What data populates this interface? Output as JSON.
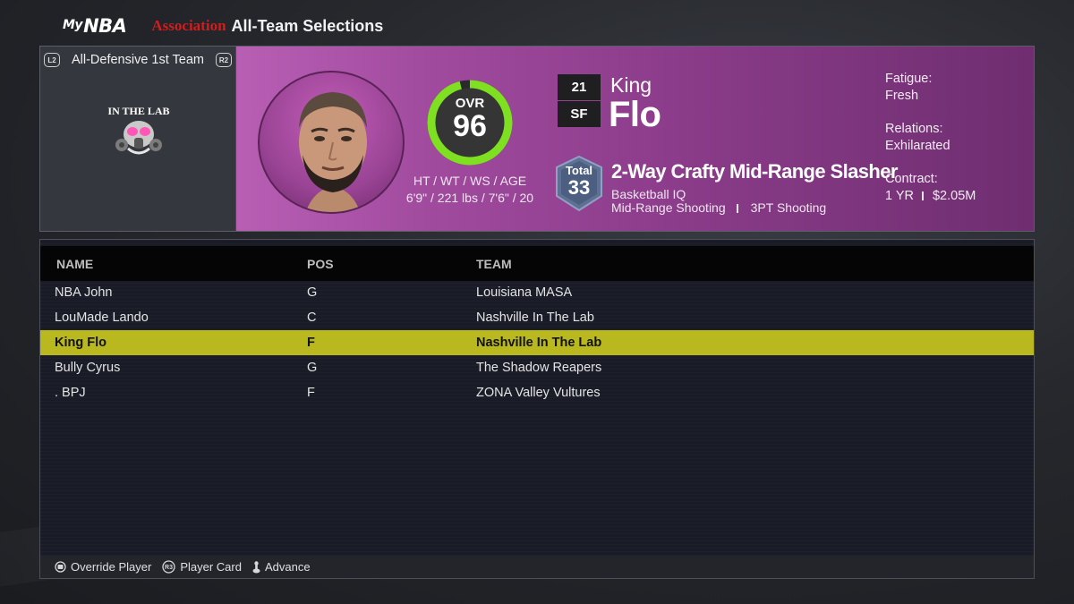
{
  "header": {
    "logo": "NBA",
    "logo_prefix": "My",
    "mode": "Association",
    "title": "All-Team Selections"
  },
  "award": {
    "left_shoulder": "L2",
    "right_shoulder": "R2",
    "label": "All-Defensive 1st Team"
  },
  "team_logo_text": "IN THE LAB",
  "player": {
    "ovr_label": "OVR",
    "ovr": "96",
    "ovr_fraction": 0.96,
    "hwa_label": "HT / WT / WS / AGE",
    "hwa_value": "6'9\" / 221 lbs / 7'6\" / 20",
    "number": "21",
    "position": "SF",
    "first_name": "King",
    "last_name": "Flo",
    "total_label": "Total",
    "total": "33",
    "archetype": "2-Way Crafty Mid-Range Slasher",
    "badge_1": "Basketball IQ",
    "badge_2": "Mid-Range Shooting",
    "badge_3": "3PT Shooting",
    "fatigue_label": "Fatigue:",
    "fatigue_value": "Fresh",
    "relations_label": "Relations:",
    "relations_value": "Exhilarated",
    "contract_label": "Contract:",
    "contract_years": "1 YR",
    "contract_amount": "$2.05M"
  },
  "table": {
    "headers": {
      "name": "NAME",
      "pos": "POS",
      "team": "TEAM"
    },
    "rows": [
      {
        "name": "NBA John",
        "pos": "G",
        "team": "Louisiana MASA"
      },
      {
        "name": "LouMade Lando",
        "pos": "C",
        "team": "Nashville In The Lab"
      },
      {
        "name": "King Flo",
        "pos": "F",
        "team": "Nashville In The Lab"
      },
      {
        "name": "Bully Cyrus",
        "pos": "G",
        "team": "The Shadow Reapers"
      },
      {
        "name": ". BPJ",
        "pos": "F",
        "team": "ZONA Valley Vultures"
      }
    ],
    "selected_index": 2
  },
  "footer": {
    "override": "Override Player",
    "player_card_button": "R3",
    "player_card": "Player Card",
    "advance": "Advance"
  },
  "colors": {
    "accent_red": "#d01d1d",
    "selection": "#b9b81f",
    "ovr_ring": "#7ee020"
  }
}
